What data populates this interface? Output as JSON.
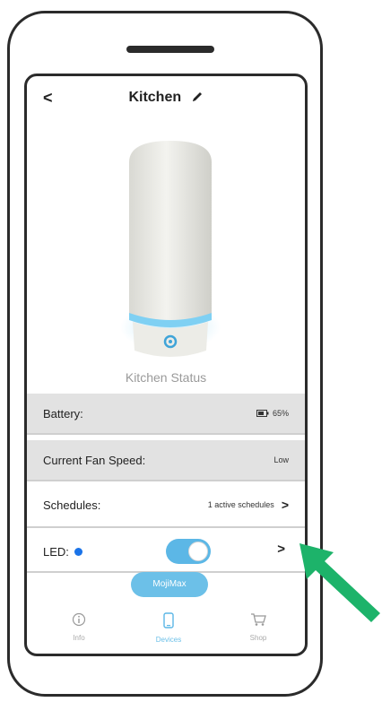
{
  "header": {
    "back_label": "<",
    "title": "Kitchen"
  },
  "device_status_label": "Kitchen Status",
  "rows": {
    "battery": {
      "label": "Battery:",
      "value": "65%"
    },
    "fan_speed": {
      "label": "Current Fan Speed:",
      "value": "Low"
    },
    "schedules": {
      "label": "Schedules:",
      "value": "1 active schedules",
      "chevron": ">"
    },
    "led": {
      "label": "LED:",
      "enabled": true,
      "chevron": ">"
    }
  },
  "mojimax_button": "MojiMax",
  "tabs": [
    {
      "label": "Info",
      "icon": "info-icon",
      "active": false
    },
    {
      "label": "Devices",
      "icon": "device-icon",
      "active": true
    },
    {
      "label": "Shop",
      "icon": "cart-icon",
      "active": false
    }
  ],
  "colors": {
    "accent": "#5cb7e6",
    "led_dot": "#1a73e8",
    "arrow": "#1db36a",
    "row_gray": "#e2e2e2"
  }
}
